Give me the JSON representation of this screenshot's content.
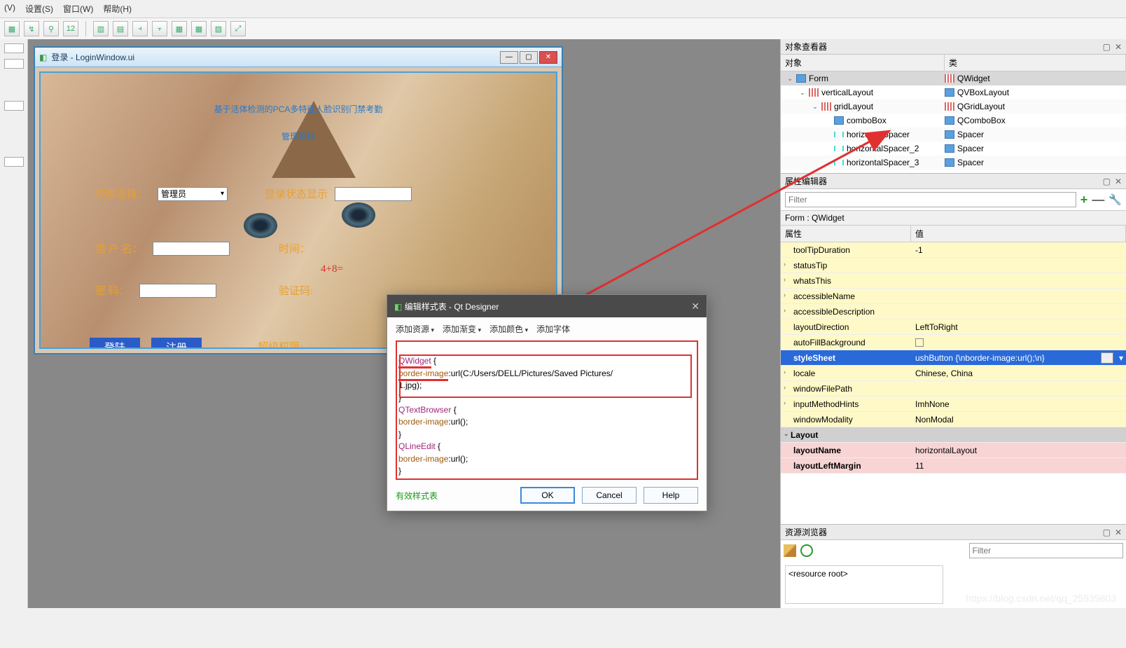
{
  "menu": {
    "v": "(V)",
    "settings": "设置(S)",
    "window": "窗口(W)",
    "help": "帮助(H)"
  },
  "design_window": {
    "title": "登录 - LoginWindow.ui",
    "big_title_l1": "基于活体检测的PCA多特征人脸识别门禁考勤",
    "big_title_l2": "管理系统",
    "perm_label": "权限选择：",
    "perm_value": "管理员",
    "login_state": "登录状态显示",
    "user_label": "用 户 名：",
    "time_label": "时间：",
    "equation": "4+8=",
    "pwd_label": "密    码：",
    "verify_label": "验证码:",
    "login_btn": "登陆",
    "reg_btn": "注册",
    "super_label": "超级权限:"
  },
  "dialog": {
    "title": "编辑样式表 - Qt Designer",
    "tb": {
      "res": "添加资源",
      "grad": "添加渐变",
      "color": "添加颜色",
      "font": "添加字体"
    },
    "code": {
      "l1a": "QWidget",
      "l1b": " {",
      "l2a": "border-image",
      "l2b": ":url(C:/Users/DELL/Pictures/Saved Pictures/",
      "l3": "1.jpg);",
      "l4": "}",
      "l5a": "QTextBrowser",
      "l5b": " {",
      "l6a": "border-image",
      "l6b": ":url();",
      "l7": "}",
      "l8a": "QLineEdit",
      "l8b": " {",
      "l9a": "border-image",
      "l9b": ":url();",
      "l10": "}"
    },
    "valid": "有效样式表",
    "ok": "OK",
    "cancel": "Cancel",
    "help": "Help"
  },
  "obj_inspector": {
    "title": "对象查看器",
    "col1": "对象",
    "col2": "类",
    "rows": [
      {
        "indent": 0,
        "exp": "⌄",
        "name": "Form",
        "cls": "QWidget",
        "ico": "sq",
        "sel": true,
        "cls_ico": "grid"
      },
      {
        "indent": 1,
        "exp": "⌄",
        "name": "verticalLayout",
        "cls": "QVBoxLayout",
        "ico": "grid"
      },
      {
        "indent": 2,
        "exp": "⌄",
        "name": "gridLayout",
        "cls": "QGridLayout",
        "ico": "grid",
        "cls_ico": "grid"
      },
      {
        "indent": 3,
        "exp": "",
        "name": "comboBox",
        "cls": "QComboBox",
        "ico": "sq"
      },
      {
        "indent": 3,
        "exp": "",
        "name": "horizontalSpacer",
        "cls": "Spacer",
        "ico": "sp"
      },
      {
        "indent": 3,
        "exp": "",
        "name": "horizontalSpacer_2",
        "cls": "Spacer",
        "ico": "sp"
      },
      {
        "indent": 3,
        "exp": "",
        "name": "horizontalSpacer_3",
        "cls": "Spacer",
        "ico": "sp"
      }
    ]
  },
  "prop_editor": {
    "title": "属性编辑器",
    "filter_ph": "Filter",
    "crumb": "Form : QWidget",
    "col1": "属性",
    "col2": "值",
    "rows": [
      {
        "n": "toolTipDuration",
        "v": "-1",
        "c": "yellow"
      },
      {
        "n": "statusTip",
        "v": "",
        "c": "yellow",
        "exp": "›"
      },
      {
        "n": "whatsThis",
        "v": "",
        "c": "yellow",
        "exp": "›"
      },
      {
        "n": "accessibleName",
        "v": "",
        "c": "yellow",
        "exp": "›"
      },
      {
        "n": "accessibleDescription",
        "v": "",
        "c": "yellow",
        "exp": "›"
      },
      {
        "n": "layoutDirection",
        "v": "LeftToRight",
        "c": "yellow"
      },
      {
        "n": "autoFillBackground",
        "v": "",
        "c": "yellow",
        "chk": true
      },
      {
        "n": "styleSheet",
        "v": "ushButton {\\nborder-image:url();\\n}",
        "c": "selected",
        "dots": true
      },
      {
        "n": "locale",
        "v": "Chinese, China",
        "c": "yellow",
        "exp": "›"
      },
      {
        "n": "windowFilePath",
        "v": "",
        "c": "yellow",
        "exp": "›"
      },
      {
        "n": "inputMethodHints",
        "v": "ImhNone",
        "c": "yellow",
        "exp": "›"
      },
      {
        "n": "windowModality",
        "v": "NonModal",
        "c": "yellow"
      },
      {
        "n": "Layout",
        "v": "",
        "c": "group",
        "exp": "⌄"
      },
      {
        "n": "layoutName",
        "v": "horizontalLayout",
        "c": "pink"
      },
      {
        "n": "layoutLeftMargin",
        "v": "11",
        "c": "pink"
      }
    ]
  },
  "res_browser": {
    "title": "资源浏览器",
    "filter_ph": "Filter",
    "root": "<resource root>"
  },
  "watermark": "https://blog.csdn.net/qq_25939803"
}
